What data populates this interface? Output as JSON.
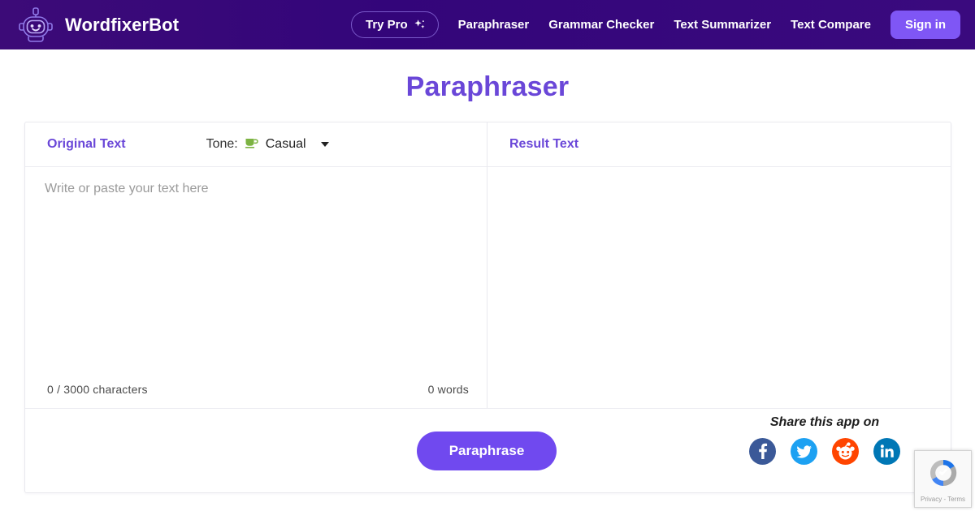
{
  "header": {
    "brand_name": "WordfixerBot",
    "logo_icon": "robot-head-icon",
    "try_pro_label": "Try Pro",
    "sparkle_icon": "sparkle-icon",
    "nav_links": [
      {
        "label": "Paraphraser"
      },
      {
        "label": "Grammar Checker"
      },
      {
        "label": "Text Summarizer"
      },
      {
        "label": "Text Compare"
      }
    ],
    "sign_in_label": "Sign in"
  },
  "hero": {
    "title": "Paraphraser"
  },
  "editor_panel": {
    "title": "Original Text",
    "tone_label": "Tone:",
    "tone_icon": "coffee-cup-icon",
    "tone_value": "Casual",
    "dropdown_icon": "chevron-down-icon",
    "placeholder": "Write or paste your text here",
    "character_count": "0 / 3000 characters",
    "word_count": "0 words"
  },
  "result_panel": {
    "title": "Result Text",
    "content": ""
  },
  "actions": {
    "paraphrase_label": "Paraphrase"
  },
  "share": {
    "label": "Share this app on",
    "networks": [
      {
        "name": "facebook",
        "icon": "facebook-icon",
        "color": "#3b5998"
      },
      {
        "name": "twitter",
        "icon": "twitter-icon",
        "color": "#1da1f2"
      },
      {
        "name": "reddit",
        "icon": "reddit-icon",
        "color": "#ff4500"
      },
      {
        "name": "linkedin",
        "icon": "linkedin-icon",
        "color": "#0077b5"
      }
    ]
  },
  "recaptcha": {
    "icon": "recaptcha-icon",
    "terms": "Privacy - Terms"
  },
  "colors": {
    "header_bg": "#3c0b78",
    "accent_purple": "#6a47d8",
    "button_purple": "#7049ef",
    "signin_purple": "#7f56f5"
  }
}
